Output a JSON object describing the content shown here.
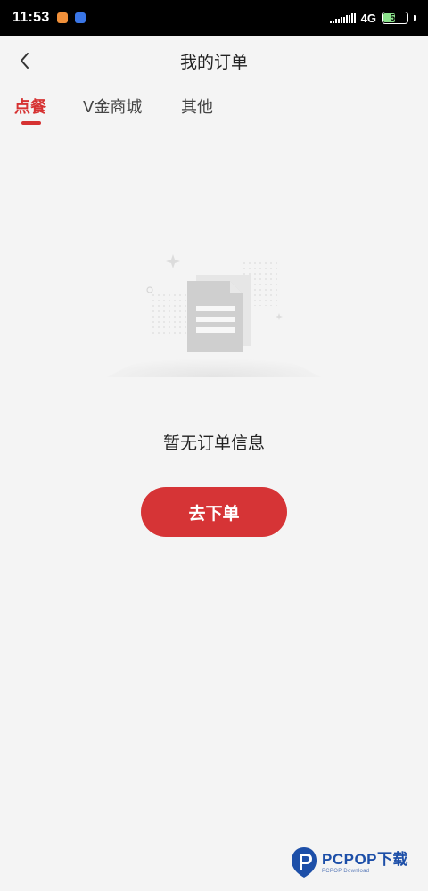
{
  "status_bar": {
    "time": "11:53",
    "network": "4G",
    "battery": "51",
    "battery_level": 0.51,
    "app_icons": [
      "orange-app-icon",
      "blue-app-icon"
    ]
  },
  "header": {
    "title": "我的订单",
    "back_icon": "chevron-left-icon"
  },
  "tabs": [
    {
      "label": "点餐",
      "active": true
    },
    {
      "label": "V金商城",
      "active": false
    },
    {
      "label": "其他",
      "active": false
    }
  ],
  "empty_state": {
    "illustration_icon": "empty-document-icon",
    "message": "暂无订单信息",
    "button_label": "去下单"
  },
  "watermark": {
    "main": "PCPOP下载",
    "sub": "PCPOP Download"
  },
  "colors": {
    "accent": "#d63232",
    "background": "#f4f4f4",
    "status_bar": "#000000"
  }
}
